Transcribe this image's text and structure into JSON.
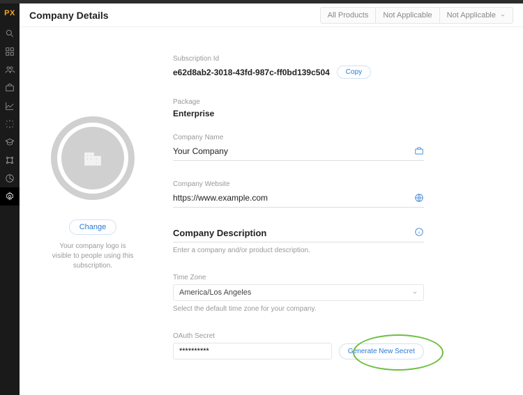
{
  "brand": "PX",
  "header": {
    "title": "Company Details",
    "segments": [
      "All Products",
      "Not Applicable",
      "Not Applicable"
    ]
  },
  "logo_panel": {
    "change_label": "Change",
    "note": "Your company logo is visible to people using this subscription."
  },
  "fields": {
    "subscription": {
      "label": "Subscription Id",
      "value": "e62d8ab2-3018-43fd-987c-ff0bd139c504",
      "copy_label": "Copy"
    },
    "package": {
      "label": "Package",
      "value": "Enterprise"
    },
    "company_name": {
      "label": "Company Name",
      "value": "Your Company"
    },
    "company_website": {
      "label": "Company Website",
      "value": "https://www.example.com"
    },
    "company_description": {
      "placeholder": "Company Description",
      "hint": "Enter a company and/or product description."
    },
    "time_zone": {
      "label": "Time Zone",
      "value": "America/Los Angeles",
      "hint": "Select the default time zone for your company."
    },
    "oauth": {
      "label": "OAuth Secret",
      "masked": "**********",
      "button": "Generate New Secret"
    }
  }
}
